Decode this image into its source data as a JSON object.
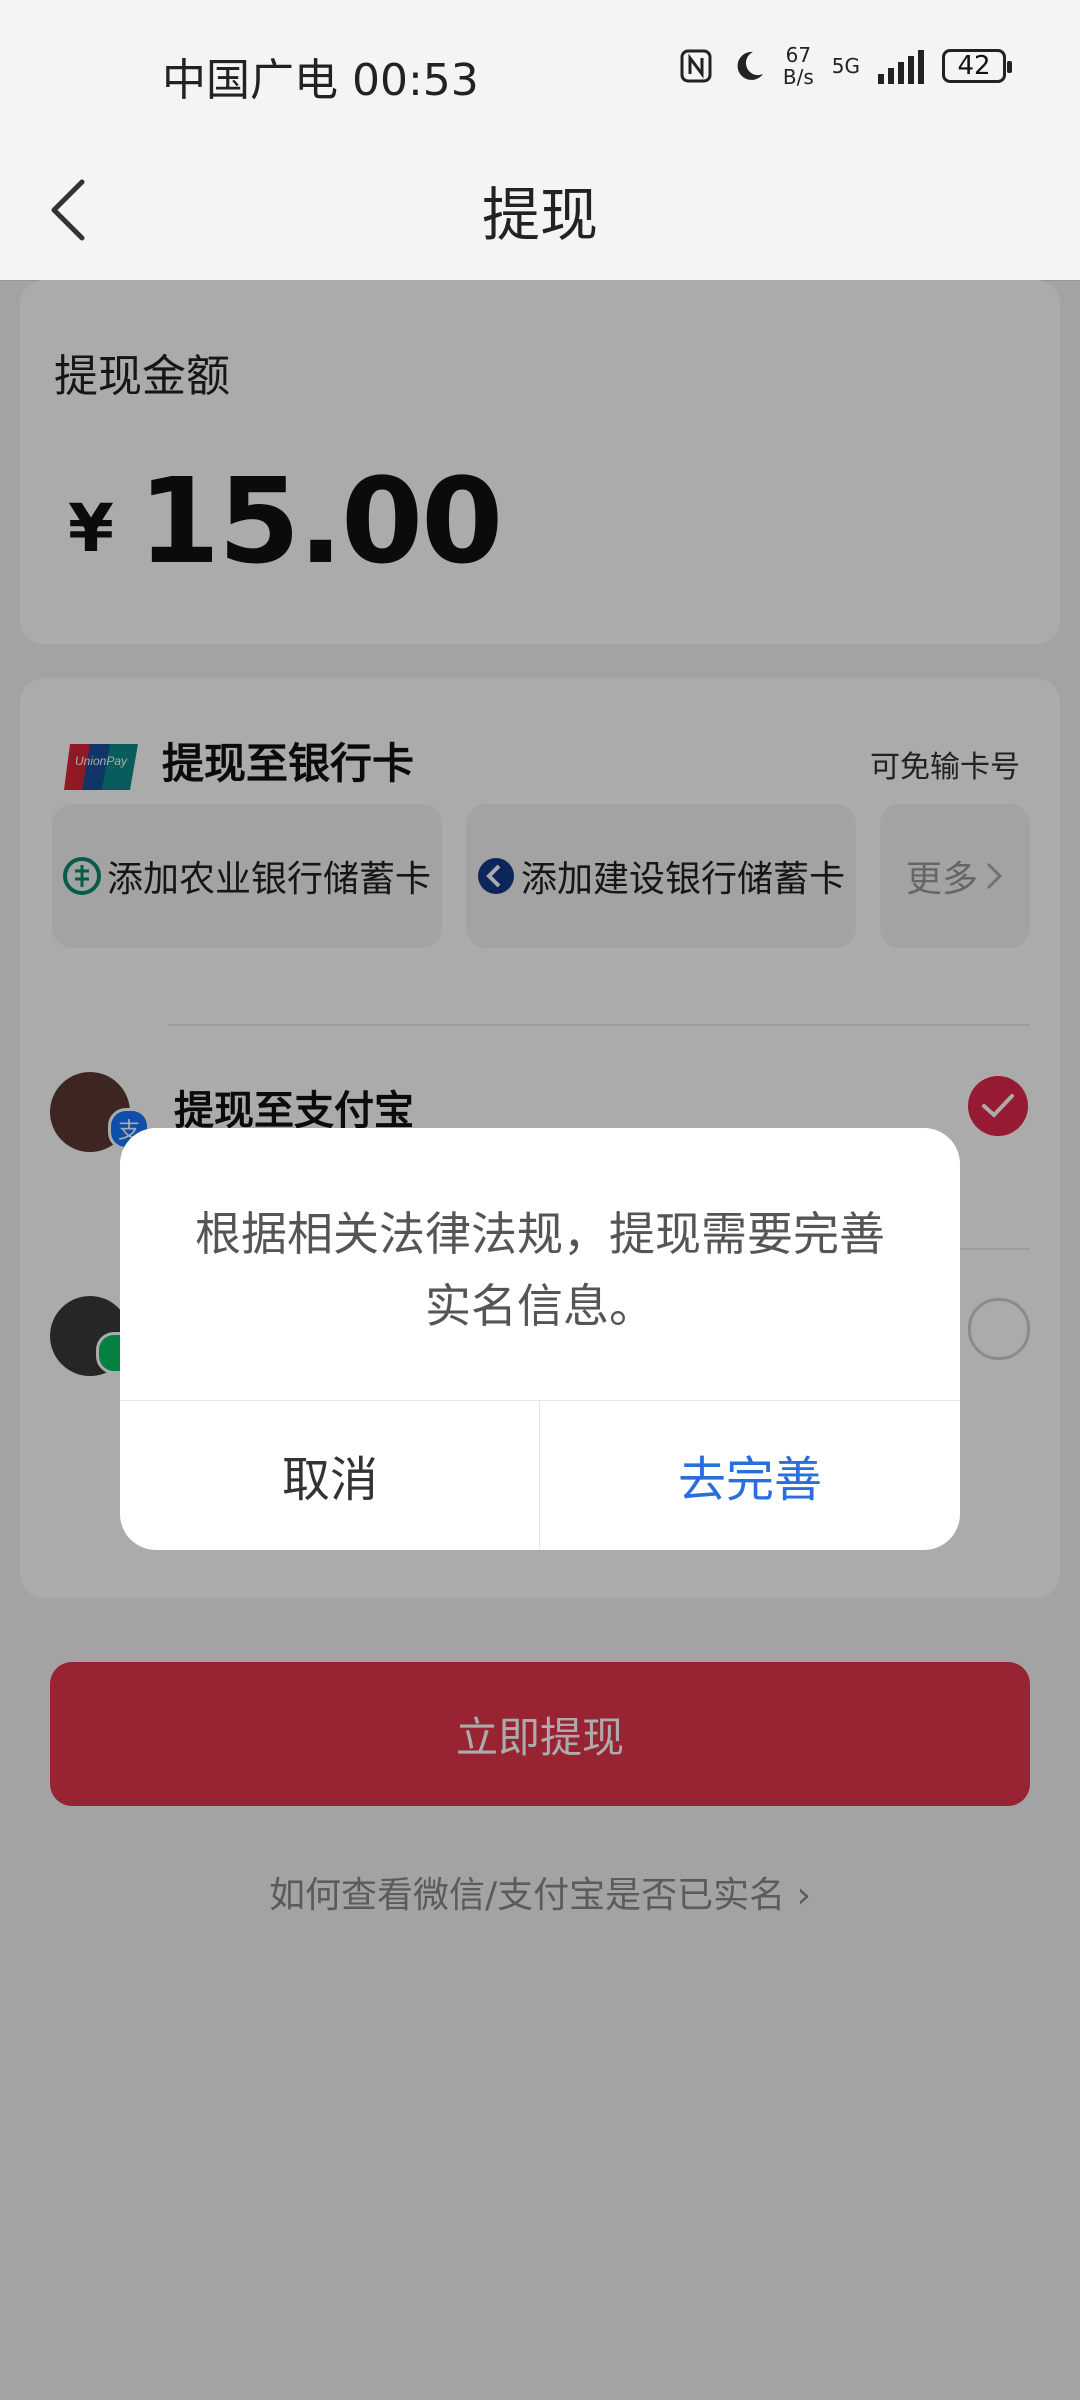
{
  "status_bar": {
    "carrier_time": "中国广电 00:53",
    "net_speed_value": "67",
    "net_speed_unit": "B/s",
    "signal_type": "5G",
    "battery": "42"
  },
  "header": {
    "title": "提现"
  },
  "amount": {
    "label": "提现金额",
    "currency": "¥",
    "value": "15.00"
  },
  "bank": {
    "title": "提现至银行卡",
    "no_card_input": "可免输卡号",
    "options": [
      {
        "label": "添加农业银行储蓄卡",
        "icon": "abc-bank-icon"
      },
      {
        "label": "添加建设银行储蓄卡",
        "icon": "ccb-bank-icon"
      }
    ],
    "more": "更多"
  },
  "alipay": {
    "label": "提现至支付宝",
    "badge": "支",
    "selected": true
  },
  "wechat": {
    "selected": false
  },
  "submit_label": "立即提现",
  "help_link": "如何查看微信/支付宝是否已实名",
  "dialog": {
    "message": "根据相关法律法规，提现需要完善实名信息。",
    "cancel": "取消",
    "confirm": "去完善"
  },
  "colors": {
    "accent_red": "#e1354c",
    "dialog_confirm_blue": "#2a6edb",
    "alipay_blue": "#1677ff",
    "wechat_green": "#07c160"
  }
}
